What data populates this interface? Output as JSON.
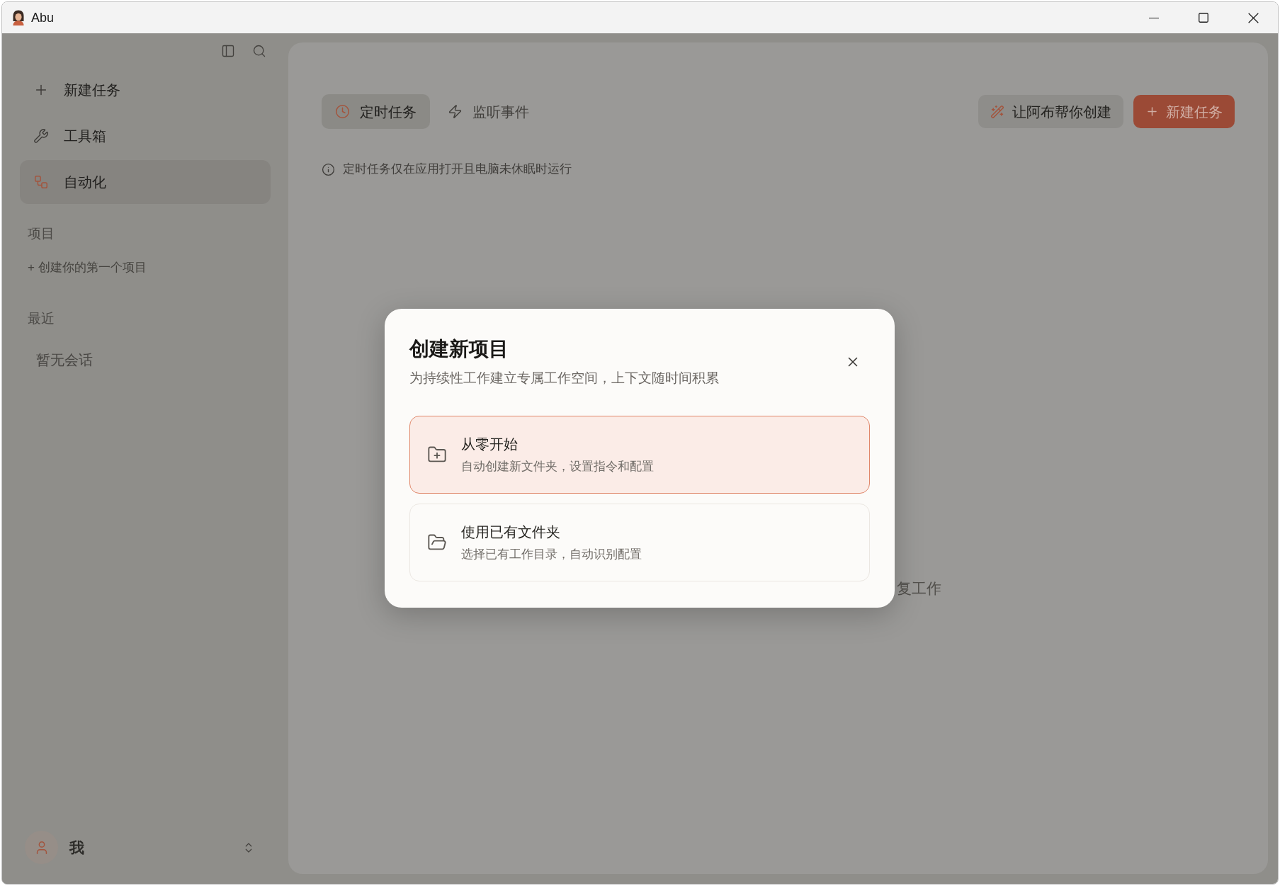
{
  "window": {
    "title": "Abu"
  },
  "sidebar": {
    "nav": [
      {
        "label": "新建任务",
        "selected": false
      },
      {
        "label": "工具箱",
        "selected": false
      },
      {
        "label": "自动化",
        "selected": true
      }
    ],
    "projects": {
      "heading": "项目",
      "create_link": "+ 创建你的第一个项目"
    },
    "recent": {
      "heading": "最近",
      "empty": "暂无会话"
    },
    "user": {
      "name": "我"
    }
  },
  "main": {
    "tabs": [
      {
        "label": "定时任务",
        "selected": true
      },
      {
        "label": "监听事件",
        "selected": false
      }
    ],
    "actions": [
      {
        "label": "让阿布帮你创建",
        "kind": "assist"
      },
      {
        "label": "新建任务",
        "kind": "primary"
      }
    ],
    "notice": "定时任务仅在应用打开且电脑未休眠时运行",
    "empty_state_fragment": "复工作"
  },
  "dialog": {
    "title": "创建新项目",
    "subtitle": "为持续性工作建立专属工作空间，上下文随时间积累",
    "options": [
      {
        "title": "从零开始",
        "description": "自动创建新文件夹，设置指令和配置",
        "selected": true
      },
      {
        "title": "使用已有文件夹",
        "description": "选择已有工作目录，自动识别配置",
        "selected": false
      }
    ]
  }
}
